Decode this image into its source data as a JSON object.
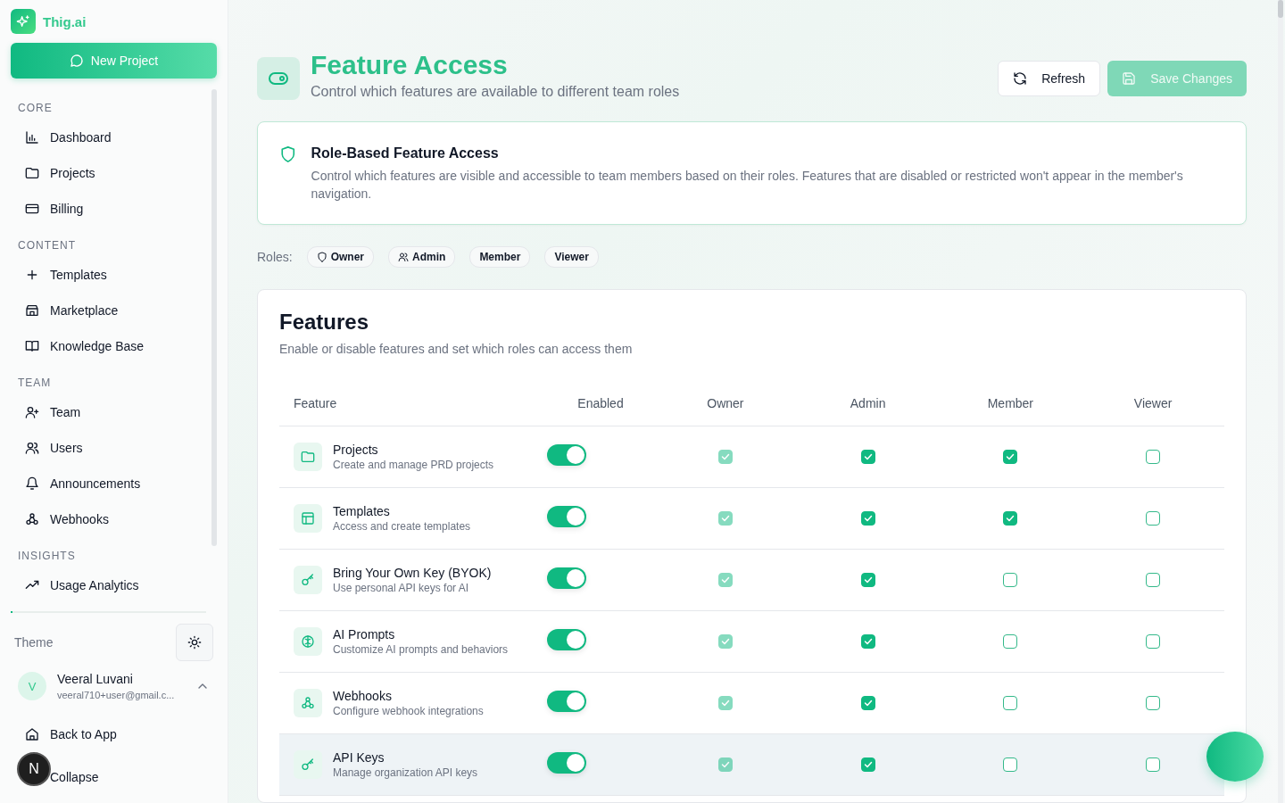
{
  "sidebar": {
    "brand": "Thig.ai",
    "new_button": "New Project",
    "sections": [
      {
        "title": "CORE",
        "items": [
          {
            "label": "Dashboard"
          },
          {
            "label": "Projects"
          },
          {
            "label": "Billing"
          }
        ]
      },
      {
        "title": "CONTENT",
        "items": [
          {
            "label": "Templates"
          },
          {
            "label": "Marketplace"
          },
          {
            "label": "Knowledge Base"
          }
        ]
      },
      {
        "title": "TEAM",
        "items": [
          {
            "label": "Team"
          },
          {
            "label": "Users"
          },
          {
            "label": "Announcements"
          },
          {
            "label": "Webhooks"
          }
        ]
      },
      {
        "title": "INSIGHTS",
        "items": [
          {
            "label": "Usage Analytics"
          }
        ]
      }
    ],
    "theme_label": "Theme",
    "user": {
      "initial": "V",
      "name": "Veeral Luvani",
      "email": "veeral710+user@gmail.c..."
    },
    "back_link": "Back to App",
    "collapse": "Collapse",
    "dev_badge": "N"
  },
  "header": {
    "title": "Feature Access",
    "subtitle": "Control which features are available to different team roles",
    "refresh": "Refresh",
    "save": "Save Changes",
    "save_disabled": true
  },
  "notice": {
    "title": "Role-Based Feature Access",
    "text": "Control which features are visible and accessible to team members based on their roles. Features that are disabled or restricted won't appear in the member's navigation."
  },
  "roles": {
    "label": "Roles:",
    "chips": [
      "Owner",
      "Admin",
      "Member",
      "Viewer"
    ]
  },
  "features": {
    "title": "Features",
    "subtitle": "Enable or disable features and set which roles can access them",
    "columns": [
      "Feature",
      "Enabled",
      "Owner",
      "Admin",
      "Member",
      "Viewer"
    ],
    "rows": [
      {
        "name": "Projects",
        "description": "Create and manage PRD projects",
        "enabled": true,
        "hovered": false,
        "access": [
          {
            "checked": true,
            "disabled": true
          },
          {
            "checked": true,
            "disabled": false
          },
          {
            "checked": true,
            "disabled": false
          },
          {
            "checked": false,
            "disabled": false
          }
        ]
      },
      {
        "name": "Templates",
        "description": "Access and create templates",
        "enabled": true,
        "hovered": false,
        "access": [
          {
            "checked": true,
            "disabled": true
          },
          {
            "checked": true,
            "disabled": false
          },
          {
            "checked": true,
            "disabled": false
          },
          {
            "checked": false,
            "disabled": false
          }
        ]
      },
      {
        "name": "Bring Your Own Key (BYOK)",
        "description": "Use personal API keys for AI",
        "enabled": true,
        "hovered": false,
        "access": [
          {
            "checked": true,
            "disabled": true
          },
          {
            "checked": true,
            "disabled": false
          },
          {
            "checked": false,
            "disabled": false
          },
          {
            "checked": false,
            "disabled": false
          }
        ]
      },
      {
        "name": "AI Prompts",
        "description": "Customize AI prompts and behaviors",
        "enabled": true,
        "hovered": false,
        "access": [
          {
            "checked": true,
            "disabled": true
          },
          {
            "checked": true,
            "disabled": false
          },
          {
            "checked": false,
            "disabled": false
          },
          {
            "checked": false,
            "disabled": false
          }
        ]
      },
      {
        "name": "Webhooks",
        "description": "Configure webhook integrations",
        "enabled": true,
        "hovered": false,
        "access": [
          {
            "checked": true,
            "disabled": true
          },
          {
            "checked": true,
            "disabled": false
          },
          {
            "checked": false,
            "disabled": false
          },
          {
            "checked": false,
            "disabled": false
          }
        ]
      },
      {
        "name": "API Keys",
        "description": "Manage organization API keys",
        "enabled": true,
        "hovered": true,
        "access": [
          {
            "checked": true,
            "disabled": true
          },
          {
            "checked": true,
            "disabled": false
          },
          {
            "checked": false,
            "disabled": false
          },
          {
            "checked": false,
            "disabled": false
          }
        ]
      }
    ]
  }
}
